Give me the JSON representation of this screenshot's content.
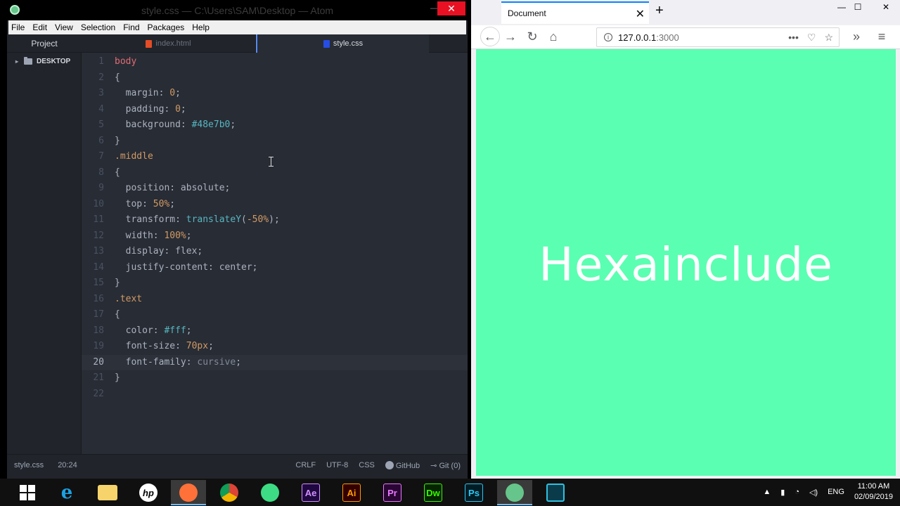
{
  "atom": {
    "title": "style.css — C:\\Users\\SAM\\Desktop — Atom",
    "menu": [
      "File",
      "Edit",
      "View",
      "Selection",
      "Find",
      "Packages",
      "Help"
    ],
    "tree_header": "Project",
    "tree_root": "DESKTOP",
    "tabs": [
      {
        "label": "index.html",
        "icon": "html5-icon"
      },
      {
        "label": "style.css",
        "icon": "css3-icon"
      }
    ],
    "status": {
      "file": "style.css",
      "cursor": "20:24",
      "line_ending": "CRLF",
      "encoding": "UTF-8",
      "grammar": "CSS",
      "github": "GitHub",
      "git": "Git (0)"
    }
  },
  "code_lines": [
    "1",
    "2",
    "3",
    "4",
    "5",
    "6",
    "7",
    "8",
    "9",
    "10",
    "11",
    "12",
    "13",
    "14",
    "15",
    "16",
    "17",
    "18",
    "19",
    "20",
    "21",
    "22"
  ],
  "code": {
    "l1": "body",
    "l2": "{",
    "l3_prop": "  margin: ",
    "l3_val": "0",
    "l3_end": ";",
    "l4_prop": "  padding: ",
    "l4_val": "0",
    "l4_end": ";",
    "l5_prop": "  background: ",
    "l5_val": "#48e7b0",
    "l5_end": ";",
    "l6": "}",
    "l7": ".middle",
    "l8": "{",
    "l9": "  position: absolute;",
    "l10_prop": "  top: ",
    "l10_val": "50%",
    "l10_end": ";",
    "l11_prop": "  transform: ",
    "l11_fn": "translateY",
    "l11_open": "(",
    "l11_val": "-50%",
    "l11_end": ");",
    "l12_prop": "  width: ",
    "l12_val": "100%",
    "l12_end": ";",
    "l13": "  display: flex;",
    "l14": "  justify-content: center;",
    "l15": "}",
    "l16": ".text",
    "l17": "{",
    "l18_prop": "  color: ",
    "l18_val": "#fff",
    "l18_end": ";",
    "l19_prop": "  font-size: ",
    "l19_val": "70px",
    "l19_end": ";",
    "l20_prop": "  font-family: ",
    "l20_val": "cursive",
    "l20_end": ";",
    "l21": "}",
    "l22": ""
  },
  "firefox": {
    "tab_title": "Document",
    "url_host": "127.0.0.1",
    "url_port": ":3000",
    "page_text": "Hexainclude",
    "page_bg": "#5affb2"
  },
  "taskbar": {
    "apps": [
      "windows-start",
      "internet-explorer",
      "file-explorer",
      "hp",
      "firefox",
      "chrome",
      "android-studio",
      "after-effects",
      "illustrator",
      "premiere",
      "dreamweaver",
      "photoshop",
      "atom",
      "screen-recorder"
    ],
    "app_labels": {
      "ae": "Ae",
      "ai": "Ai",
      "pr": "Pr",
      "dw": "Dw",
      "ps": "Ps"
    },
    "language": "ENG",
    "time": "11:00 AM",
    "date": "02/09/2019"
  }
}
